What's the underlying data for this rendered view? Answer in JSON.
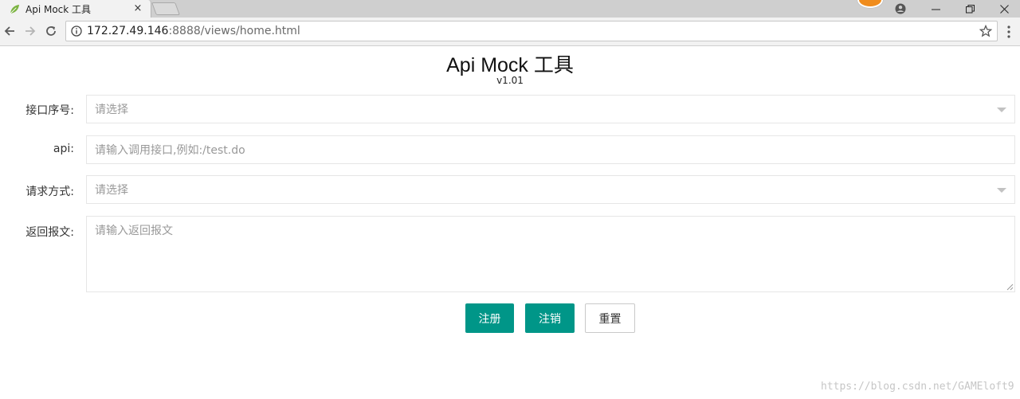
{
  "browser": {
    "tab_title": "Api Mock 工具",
    "tab_close": "×",
    "url_host": "172.27.49.146",
    "url_rest": ":8888/views/home.html"
  },
  "page": {
    "title": "Api Mock 工具",
    "version": "v1.01"
  },
  "form": {
    "interface_no": {
      "label": "接口序号:",
      "placeholder": "请选择"
    },
    "api": {
      "label": "api:",
      "placeholder": "请输入调用接口,例如:/test.do"
    },
    "method": {
      "label": "请求方式:",
      "placeholder": "请选择"
    },
    "response": {
      "label": "返回报文:",
      "placeholder": "请输入返回报文"
    }
  },
  "buttons": {
    "register": "注册",
    "unregister": "注销",
    "reset": "重置"
  },
  "watermark": "https://blog.csdn.net/GAMEloft9",
  "colors": {
    "primary": "#009688",
    "border": "#e6e6e6",
    "placeholder": "#999999"
  }
}
